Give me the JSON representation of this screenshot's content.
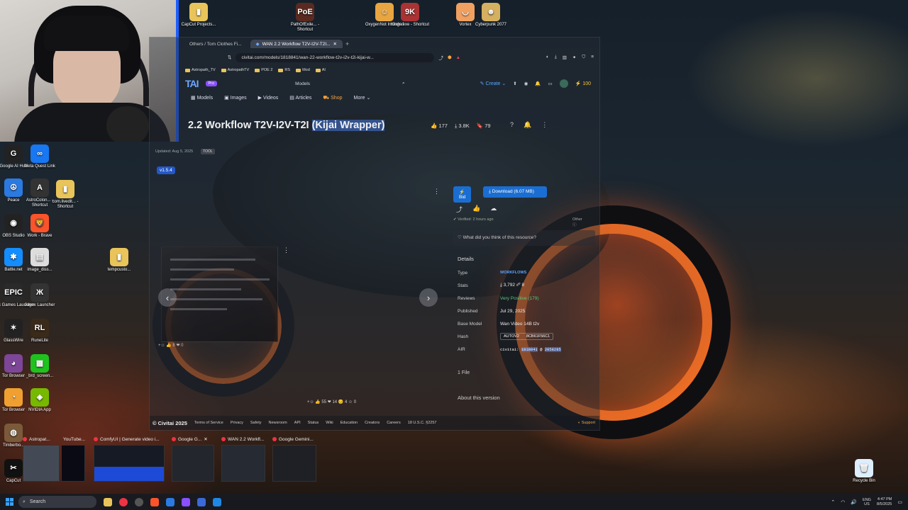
{
  "desktop": {
    "icons": [
      {
        "label": "CapCut Projects...",
        "glyph": "▮",
        "color": "#e9c45a"
      },
      {
        "label": "PathOfExile... - Shortcut",
        "glyph": "PoE",
        "color": "#5a2a20"
      },
      {
        "label": "OxygenNot Included",
        "glyph": "☺",
        "color": "#e8a540"
      },
      {
        "label": "Kings.exe - Shortcut",
        "glyph": "9K",
        "color": "#a33"
      },
      {
        "label": "Vortex",
        "glyph": "◡",
        "color": "#f0a060"
      },
      {
        "label": "Cyberpunk 2077",
        "glyph": "☻",
        "color": "#d4b060"
      },
      {
        "label": "Google AI Hub",
        "glyph": "G",
        "color": "#222"
      },
      {
        "label": "Meta Quest Link",
        "glyph": "∞",
        "color": "#1877f2"
      },
      {
        "label": "Peace",
        "glyph": "☮",
        "color": "#2a7ae2"
      },
      {
        "label": "AstroColon... - Shortcut",
        "glyph": "A",
        "color": "#333"
      },
      {
        "label": "com.livedit... - Shortcut",
        "glyph": "▮",
        "color": "#e9c45a"
      },
      {
        "label": "OBS Studio",
        "glyph": "◉",
        "color": "#222"
      },
      {
        "label": "Work - Brave",
        "glyph": "🦁",
        "color": "#fb542b"
      },
      {
        "label": "Battle.net",
        "glyph": "✱",
        "color": "#148eff"
      },
      {
        "label": "image_diss...",
        "glyph": "▤",
        "color": "#ddd"
      },
      {
        "label": "tempcusto...",
        "glyph": "▮",
        "color": "#e9c45a"
      },
      {
        "label": "Epic Games Launcher",
        "glyph": "EPIC",
        "color": "#2a2a2a"
      },
      {
        "label": "Jagex Launcher",
        "glyph": "Ж",
        "color": "#333"
      },
      {
        "label": "GlassWire",
        "glyph": "✶",
        "color": "#222"
      },
      {
        "label": "RuneLite",
        "glyph": "RL",
        "color": "#3a2a1a"
      },
      {
        "label": "Tor Browser",
        "glyph": "◕",
        "color": "#7d4698"
      },
      {
        "label": "_brd_screen...",
        "glyph": "▦",
        "color": "#1ec31e"
      },
      {
        "label": "Tor Browser",
        "glyph": "◔",
        "color": "#f0a030"
      },
      {
        "label": "NVIDIA App",
        "glyph": "◈",
        "color": "#76b900"
      },
      {
        "label": "Timberbo...",
        "glyph": "◍",
        "color": "#7a5a3a"
      },
      {
        "label": "CapCut",
        "glyph": "✂",
        "color": "#111"
      },
      {
        "label": "Recycle Bin",
        "glyph": "🗑",
        "color": "#ddeeff"
      }
    ]
  },
  "browser": {
    "tabs": [
      {
        "label": "Others / Tom Clothes Fi..."
      },
      {
        "label": "WAN 2.2 Workflow T2V-I2V-T2I..."
      }
    ],
    "url": "civitai.com/models/1818841/wan-22-workflow-t2v-i2v-t2i-kijai-w...",
    "bookmarks": [
      {
        "label": "Astropath_TV"
      },
      {
        "label": "AstropathTV"
      },
      {
        "label": "POE 2"
      },
      {
        "label": "RS"
      },
      {
        "label": "Mod"
      },
      {
        "label": "AI"
      }
    ]
  },
  "civitai": {
    "logo": "TAI",
    "pro_badge": "Pro",
    "models_label": "Models",
    "create_label": "Create",
    "buzz_count": "100",
    "nav": {
      "models": "Models",
      "images": "Images",
      "videos": "Videos",
      "articles": "Articles",
      "shop": "Shop",
      "more": "More"
    },
    "title_plain": "2.2 Workflow T2V-I2V-T2I ",
    "title_highlight": "(Kijai Wrapper)",
    "stats": {
      "likes": "177",
      "downloads": "3.8K",
      "bookmarks": "79"
    },
    "updated": "Updated: Aug 5, 2025",
    "tool_tag": "TOOL",
    "version": "v1.5.4",
    "thumb_stats": "+☺ 👍 8  ❤ 0",
    "bid_label": "Bid",
    "download_label": "Download (6.07 MB)",
    "verified": "Verified: 2 hours ago",
    "other_label": "Other",
    "feedback_prompt": "What did you think of this resource?",
    "details_title": "Details",
    "details": {
      "type_key": "Type",
      "type_val": "WORKFLOWS",
      "stats_key": "Stats",
      "stats_val": "⤓ 3,792  ✐ 8",
      "reviews_key": "Reviews",
      "reviews_val": "Very Positive (179)",
      "published_key": "Published",
      "published_val": "Jul 29, 2025",
      "base_key": "Base Model",
      "base_val": "Wan Video 14B t2v",
      "hash_key": "Hash",
      "hash_algo": "AUTOV2",
      "hash_val": "8CB61F56C1",
      "air_key": "AIR",
      "air_prefix": "civitai:",
      "air_model": "1818841",
      "air_sep": " @ ",
      "air_version": "2058285"
    },
    "files_label": "1 File",
    "about_label": "About this version",
    "reactions": "+☺  👍 55  ❤ 14  😊 4  ☺ 0",
    "footer": {
      "brand": "© Civitai 2025",
      "links": [
        "Terms of Service",
        "Privacy",
        "Safety",
        "Newsroom",
        "API",
        "Status",
        "Wiki",
        "Education",
        "Creators",
        "Careers",
        "18 U.S.C. §2257"
      ],
      "support": "Support"
    }
  },
  "switcher": {
    "items": [
      {
        "label": "Astropat..."
      },
      {
        "label": "YouTube..."
      },
      {
        "label": "ComfyUI | Generate video i..."
      },
      {
        "label": "Google G..."
      },
      {
        "label": "WAN 2.2 Workfl..."
      },
      {
        "label": "Google Gemini..."
      }
    ]
  },
  "taskbar": {
    "search_placeholder": "Search",
    "lang_top": "ENG",
    "lang_bottom": "US",
    "time": "4:47 PM",
    "date": "8/5/2025"
  }
}
